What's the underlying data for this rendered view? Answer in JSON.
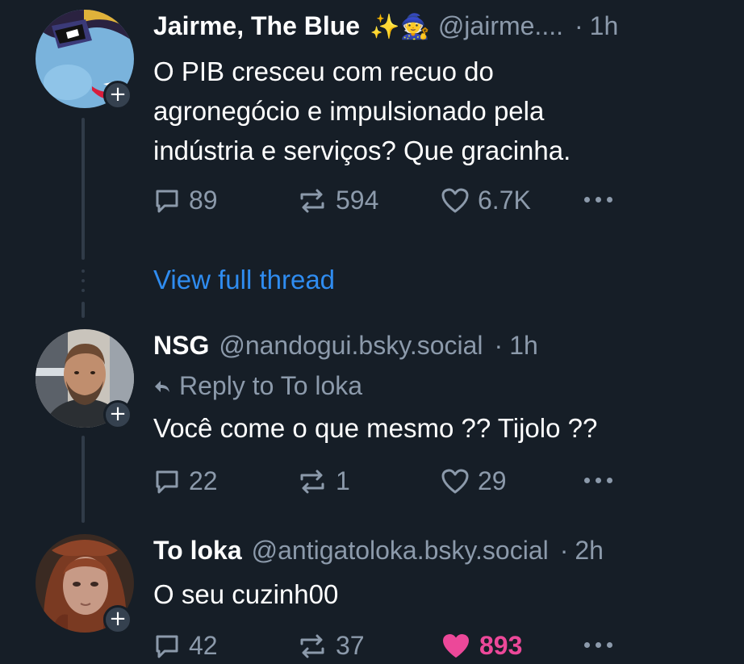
{
  "posts": [
    {
      "author_name": "Jairme, The Blue",
      "name_emojis": "✨🧙",
      "handle": "@jairme....",
      "separator": "·",
      "time": "1h",
      "text": "O PIB cresceu com recuo do\nagronegócio e impulsionado pela\nindústria e serviços? Que gracinha.",
      "replies": "89",
      "reposts": "594",
      "likes": "6.7K",
      "liked": false
    },
    {
      "author_name": "NSG",
      "handle": "@nandogui.bsky.social",
      "separator": "·",
      "time": "1h",
      "reply_to": "Reply to To loka",
      "text": "Você come o que mesmo ?? Tijolo ??",
      "replies": "22",
      "reposts": "1",
      "likes": "29",
      "liked": false
    },
    {
      "author_name": "To loka",
      "handle": "@antigatoloka.bsky.social",
      "separator": "·",
      "time": "2h",
      "text": "O seu cuzinh00",
      "replies": "42",
      "reposts": "37",
      "likes": "893",
      "liked": true
    }
  ],
  "view_full_thread": "View full thread",
  "follow_badge": "+",
  "colors": {
    "background": "#161e27",
    "muted": "#8c9aab",
    "link": "#2f8cf0",
    "like_active": "#ec4899"
  },
  "icons": [
    "comment-icon",
    "repost-icon",
    "heart-icon",
    "more-icon",
    "reply-arrow-icon",
    "plus-icon"
  ]
}
